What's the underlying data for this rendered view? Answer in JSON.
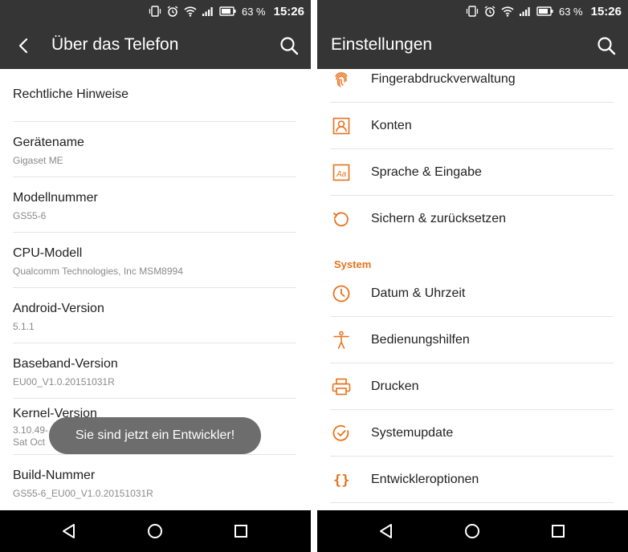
{
  "status_bar": {
    "battery_percent": "63 %",
    "time": "15:26",
    "icons": [
      "vibrate-icon",
      "alarm-icon",
      "wifi-icon",
      "signal-icon",
      "battery-icon"
    ]
  },
  "left_screen": {
    "title": "Über das Telefon",
    "items": [
      {
        "title": "Rechtliche Hinweise",
        "subtitle": ""
      },
      {
        "title": "Gerätename",
        "subtitle": "Gigaset ME"
      },
      {
        "title": "Modellnummer",
        "subtitle": "GS55-6"
      },
      {
        "title": "CPU-Modell",
        "subtitle": "Qualcomm Technologies, Inc MSM8994"
      },
      {
        "title": "Android-Version",
        "subtitle": "5.1.1"
      },
      {
        "title": "Baseband-Version",
        "subtitle": "EU00_V1.0.20151031R"
      },
      {
        "title": "Kernel-Version",
        "subtitle": "3.10.49-",
        "subtitle2": "Sat Oct"
      },
      {
        "title": "Build-Nummer",
        "subtitle": "GS55-6_EU00_V1.0.20151031R"
      }
    ],
    "toast": "Sie sind jetzt ein Entwickler!"
  },
  "right_screen": {
    "title": "Einstellungen",
    "items_top": [
      {
        "label": "Fingerabdruckverwaltung",
        "icon": "fingerprint-icon"
      },
      {
        "label": "Konten",
        "icon": "account-icon"
      },
      {
        "label": "Sprache & Eingabe",
        "icon": "language-icon"
      },
      {
        "label": "Sichern & zurücksetzen",
        "icon": "backup-icon"
      }
    ],
    "section": "System",
    "items_system": [
      {
        "label": "Datum & Uhrzeit",
        "icon": "clock-icon"
      },
      {
        "label": "Bedienungshilfen",
        "icon": "accessibility-icon"
      },
      {
        "label": "Drucken",
        "icon": "printer-icon"
      },
      {
        "label": "Systemupdate",
        "icon": "system-update-icon"
      },
      {
        "label": "Entwickleroptionen",
        "icon": "developer-braces-icon"
      }
    ]
  },
  "colors": {
    "bar": "#353535",
    "accent": "#e8711c",
    "nav": "#000000",
    "toast": "#6d6d6d"
  }
}
